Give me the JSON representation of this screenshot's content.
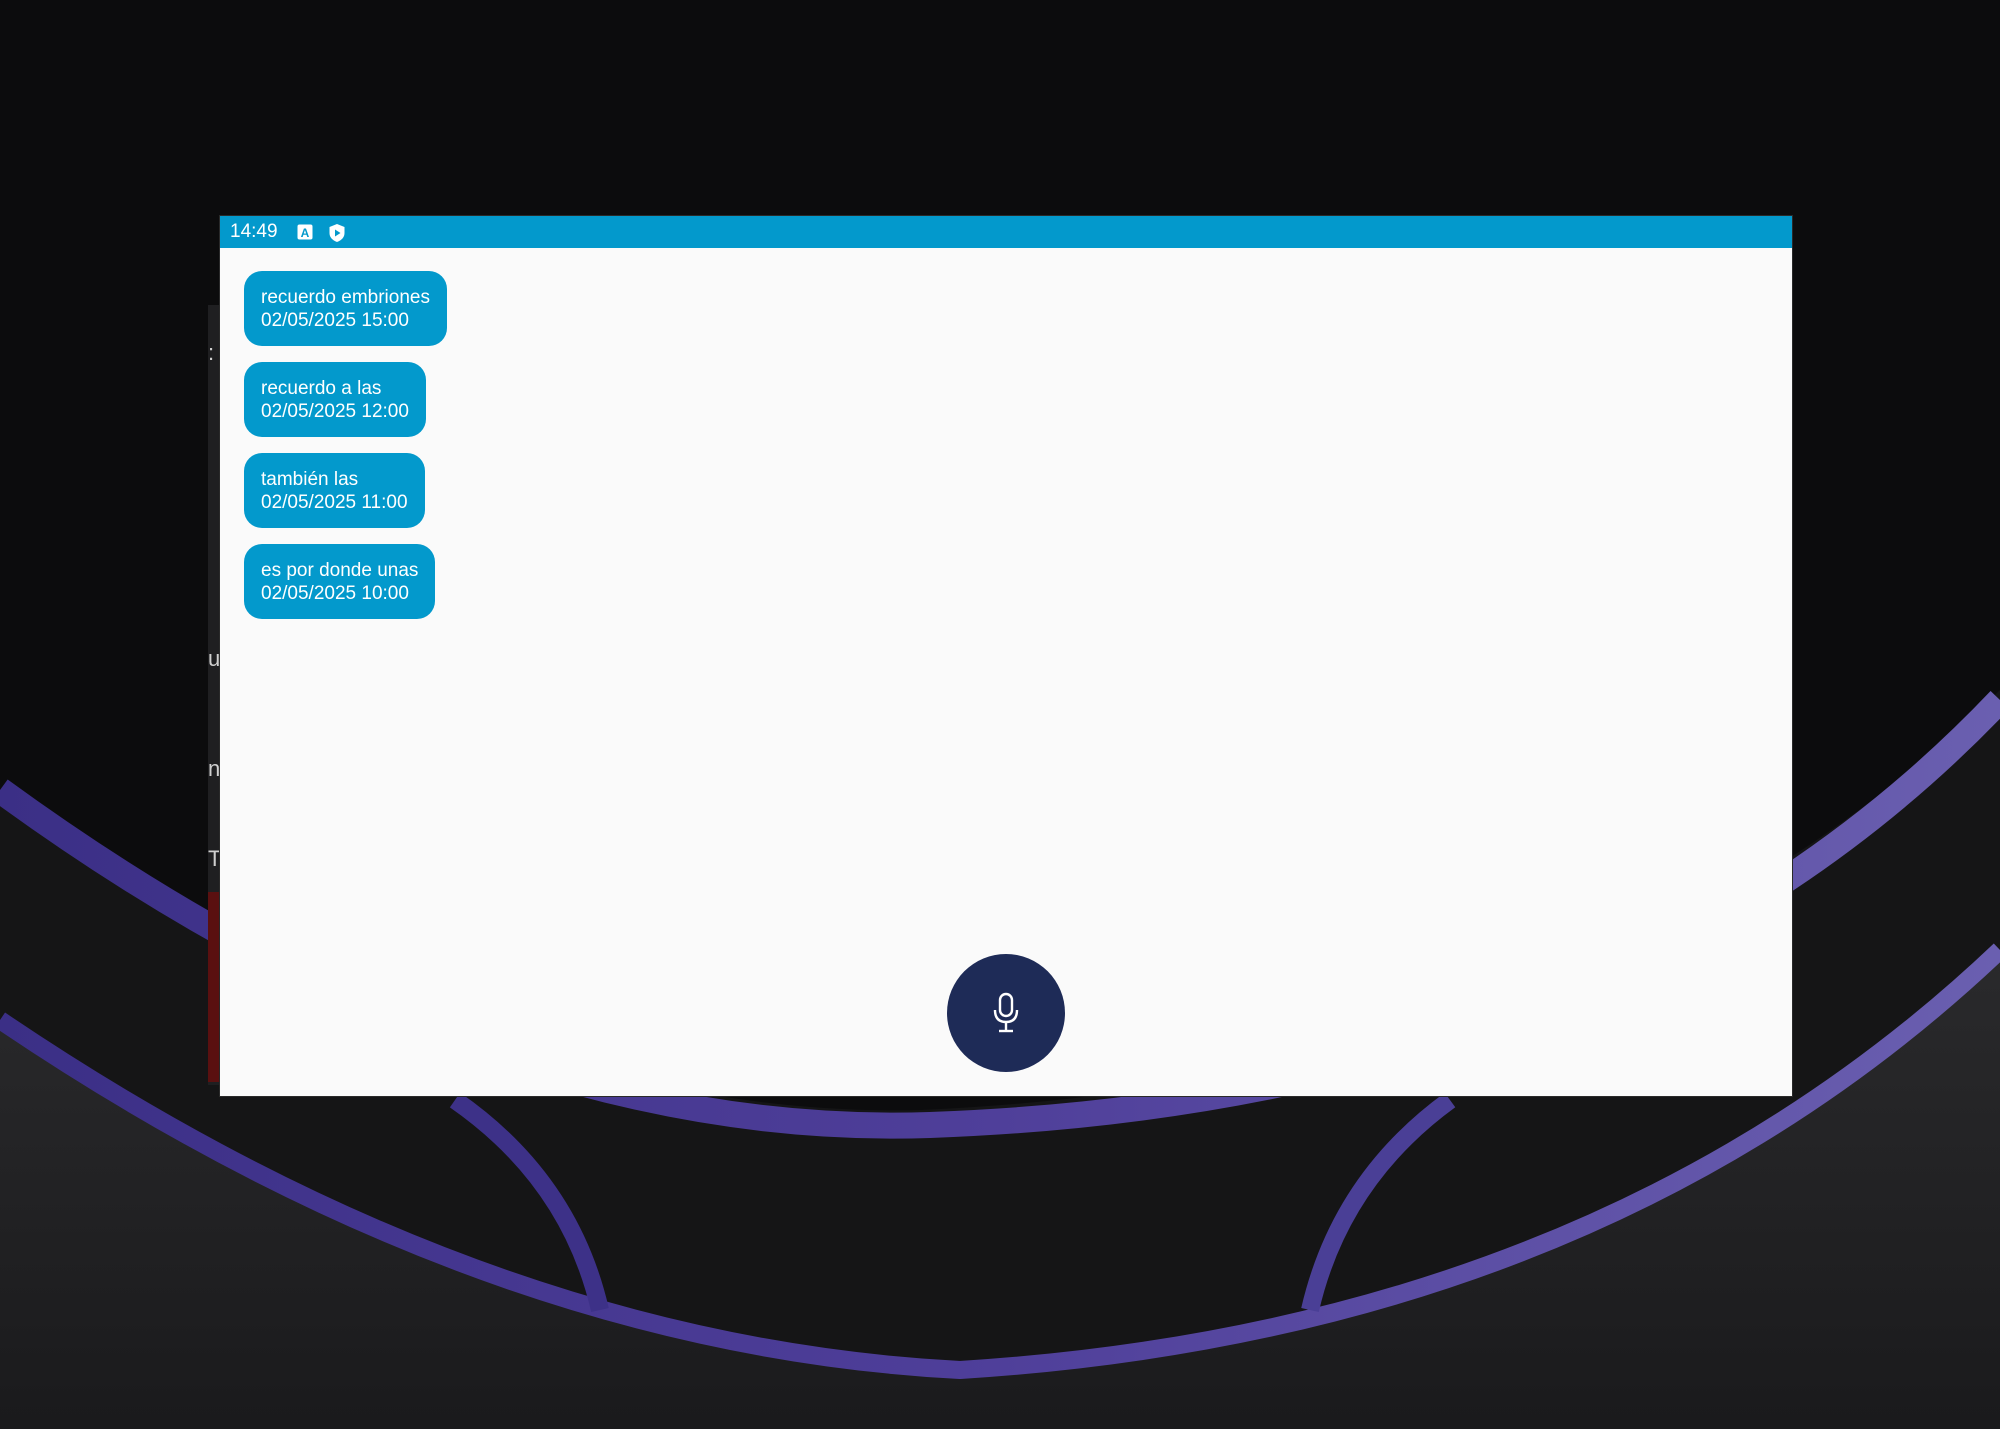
{
  "status_bar": {
    "time": "14:49",
    "icons": [
      "keyboard-a-icon",
      "shield-play-icon"
    ],
    "color": "#0399cc"
  },
  "messages": [
    {
      "text": "recuerdo embriones",
      "datetime": "02/05/2025 15:00"
    },
    {
      "text": "recuerdo a las",
      "datetime": "02/05/2025 12:00"
    },
    {
      "text": "también las",
      "datetime": "02/05/2025 11:00"
    },
    {
      "text": "es por donde unas",
      "datetime": "02/05/2025 10:00"
    }
  ],
  "mic_button": {
    "icon": "microphone-icon",
    "color": "#1e2b57"
  },
  "theme": {
    "bubble_color": "#0399cc",
    "background": "#fafafa"
  }
}
